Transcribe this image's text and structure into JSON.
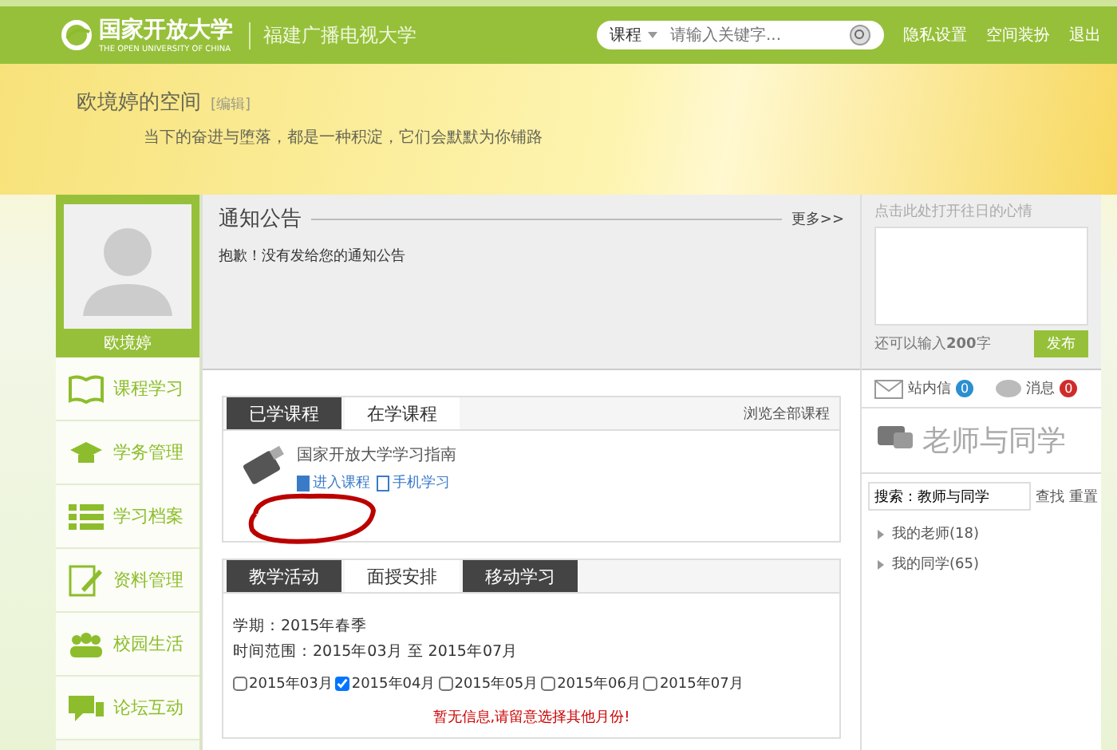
{
  "header": {
    "logo": "国家开放大学",
    "logo_sub": "THE OPEN UNIVERSITY OF CHINA",
    "school": "福建广播电视大学",
    "search": {
      "scope": "课程",
      "placeholder": "请输入关键字..."
    },
    "links": [
      "隐私设置",
      "空间装扮",
      "退出"
    ]
  },
  "banner": {
    "title": "欧境婷的空间",
    "edit": "[编辑]",
    "motto": "当下的奋进与堕落，都是一种积淀，它们会默默为你铺路"
  },
  "profile": {
    "name": "欧境婷"
  },
  "sidebar": {
    "items": [
      {
        "label": "课程学习",
        "kind": "book"
      },
      {
        "label": "学务管理",
        "kind": "cap"
      },
      {
        "label": "学习档案",
        "kind": "list"
      },
      {
        "label": "资料管理",
        "kind": "edit"
      },
      {
        "label": "校园生活",
        "kind": "people"
      },
      {
        "label": "论坛互动",
        "kind": "chat"
      }
    ]
  },
  "notice": {
    "title": "通知公告",
    "more": "更多>>",
    "message": "抱歉！没有发给您的通知公告"
  },
  "mood": {
    "hint": "点击此处打开往日的心情",
    "counter": "还可以输入**200**字",
    "button": "发布"
  },
  "courses": {
    "tabs": [
      {
        "label": "已学课程",
        "selected": false
      },
      {
        "label": "在学课程",
        "selected": true
      }
    ],
    "browse_all": "浏览全部课程",
    "items": [
      {
        "title": "国家开放大学学习指南",
        "enter": "进入课程",
        "mobile": "手机学习",
        "circled": true
      }
    ]
  },
  "activities": {
    "tabs": [
      {
        "label": "教学活动",
        "selected": false
      },
      {
        "label": "面授安排",
        "selected": true
      },
      {
        "label": "移动学习",
        "selected": false
      }
    ],
    "term": "学期：2015年春季",
    "range": "时间范围：2015年03月 至 2015年07月",
    "months": [
      {
        "label": "2015年03月",
        "checked": false
      },
      {
        "label": "2015年04月",
        "checked": true
      },
      {
        "label": "2015年05月",
        "checked": false
      },
      {
        "label": "2015年06月",
        "checked": false
      },
      {
        "label": "2015年07月",
        "checked": false
      }
    ],
    "notice": "暂无信息,请留意选择其他月份!"
  },
  "messages": [
    {
      "label": "站内信",
      "count": "0",
      "color": "#2b8fd0"
    },
    {
      "label": "消息",
      "count": "0",
      "color": "#d02b2b"
    }
  ],
  "contacts": {
    "title": "老师与同学",
    "search": "搜索：教师与同学",
    "find": "查找",
    "reset": "重置",
    "groups": [
      {
        "label": "我的老师(18)",
        "expanded": false
      },
      {
        "label": "我的同学(65)",
        "expanded": false
      }
    ]
  }
}
